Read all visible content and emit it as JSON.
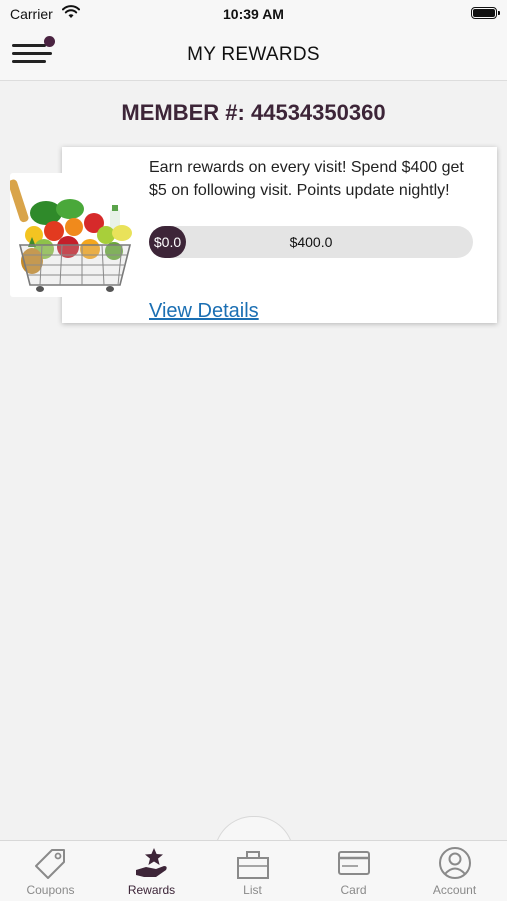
{
  "status_bar": {
    "carrier": "Carrier",
    "time": "10:39 AM"
  },
  "header": {
    "title": "MY REWARDS",
    "menu_icon": "hamburger-menu-icon"
  },
  "member": {
    "text": "MEMBER #: 44534350360"
  },
  "reward": {
    "image": "grocery-basket-image",
    "description": "Earn rewards on every visit! Spend $400 get $5 on following visit. Points update nightly!",
    "current_amount": "$0.0",
    "goal_amount": "$400.0",
    "progress_fraction": 0.0,
    "details_link": "View Details",
    "link_color": "#1b6fb3",
    "accent_color": "#3d2538"
  },
  "tabs": [
    {
      "label": "Coupons",
      "icon": "tag-icon",
      "active": false
    },
    {
      "label": "Rewards",
      "icon": "hand-star-icon",
      "active": true
    },
    {
      "label": "List",
      "icon": "basket-icon",
      "active": false
    },
    {
      "label": "Card",
      "icon": "card-icon",
      "active": false
    },
    {
      "label": "Account",
      "icon": "user-icon",
      "active": false
    }
  ]
}
